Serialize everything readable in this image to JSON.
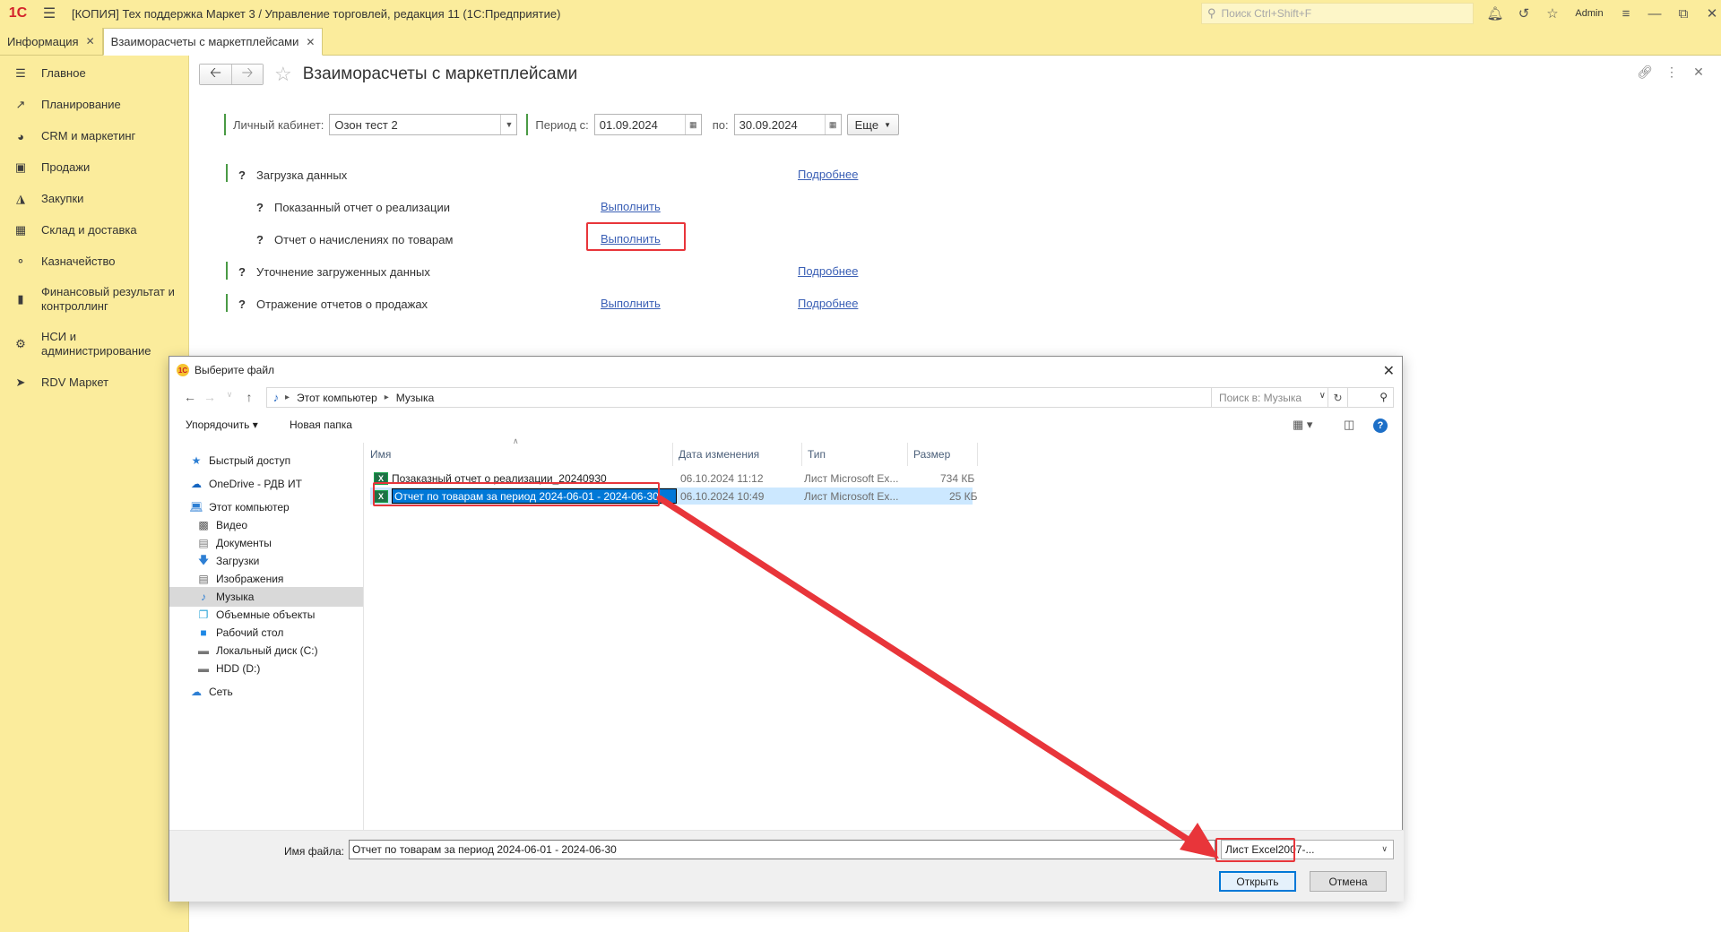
{
  "titlebar": {
    "logo": "1С",
    "title": "[КОПИЯ] Тех поддержка Маркет 3 / Управление торговлей, редакция 11  (1С:Предприятие)",
    "search_placeholder": "Поиск Ctrl+Shift+F",
    "user": "Admin"
  },
  "tabs": [
    {
      "label": "Информация"
    },
    {
      "label": "Взаиморасчеты с маркетплейсами"
    }
  ],
  "sidebar": {
    "items": [
      {
        "label": "Главное",
        "icon": "menu-icon"
      },
      {
        "label": "Планирование",
        "icon": "chart-icon"
      },
      {
        "label": "CRM и маркетинг",
        "icon": "pie-icon"
      },
      {
        "label": "Продажи",
        "icon": "bag-icon"
      },
      {
        "label": "Закупки",
        "icon": "cart-icon"
      },
      {
        "label": "Склад и доставка",
        "icon": "grid-icon"
      },
      {
        "label": "Казначейство",
        "icon": "coins-icon"
      },
      {
        "label": "Финансовый результат и контроллинг",
        "icon": "bar-chart-icon"
      },
      {
        "label": "НСИ и администрирование",
        "icon": "gear-icon"
      },
      {
        "label": "RDV Маркет",
        "icon": "rocket-icon"
      }
    ]
  },
  "page": {
    "title": "Взаиморасчеты с маркетплейсами",
    "filters": {
      "cabinet_label": "Личный кабинет:",
      "cabinet_value": "Озон тест 2",
      "period_from_label": "Период с:",
      "period_from": "01.09.2024",
      "period_to_label": "по:",
      "period_to": "30.09.2024",
      "more_label": "Еще"
    },
    "steps": [
      {
        "q": "?",
        "label": "Загрузка данных",
        "link2": "Подробнее"
      },
      {
        "q": "?",
        "label": "Показанный отчет о реализации",
        "link1": "Выполнить"
      },
      {
        "q": "?",
        "label": "Отчет о начислениях по товарам",
        "link1": "Выполнить"
      },
      {
        "q": "?",
        "label": "Уточнение загруженных данных",
        "link2": "Подробнее"
      },
      {
        "q": "?",
        "label": "Отражение отчетов о продажах",
        "link1": "Выполнить",
        "link2": "Подробнее"
      }
    ]
  },
  "dialog": {
    "title": "Выберите файл",
    "path": [
      "Этот компьютер",
      "Музыка"
    ],
    "search_placeholder": "Поиск в: Музыка",
    "organize_label": "Упорядочить ▾",
    "new_folder_label": "Новая папка",
    "help": "?",
    "tree": [
      {
        "label": "Быстрый доступ",
        "icon": "star-icon"
      },
      {
        "label": "OneDrive - РДВ ИТ",
        "icon": "cloud-icon"
      },
      {
        "label": "Этот компьютер",
        "icon": "computer-icon"
      },
      {
        "label": "Видео",
        "icon": "video-icon"
      },
      {
        "label": "Документы",
        "icon": "document-icon"
      },
      {
        "label": "Загрузки",
        "icon": "download-icon"
      },
      {
        "label": "Изображения",
        "icon": "image-icon"
      },
      {
        "label": "Музыка",
        "icon": "music-icon"
      },
      {
        "label": "Объемные объекты",
        "icon": "cube-icon"
      },
      {
        "label": "Рабочий стол",
        "icon": "desktop-icon"
      },
      {
        "label": "Локальный диск (C:)",
        "icon": "drive-icon"
      },
      {
        "label": "HDD (D:)",
        "icon": "hdd-icon"
      },
      {
        "label": "Сеть",
        "icon": "network-icon"
      }
    ],
    "columns": [
      "Имя",
      "Дата изменения",
      "Тип",
      "Размер"
    ],
    "files": [
      {
        "name": "Позаказный отчет о реализации_20240930",
        "date": "06.10.2024 11:12",
        "type": "Лист Microsoft Ex...",
        "size": "734 КБ"
      },
      {
        "name": "Отчет по товарам за период 2024-06-01 - 2024-06-30",
        "date": "06.10.2024 10:49",
        "type": "Лист Microsoft Ex...",
        "size": "25 КБ"
      }
    ],
    "filename_label": "Имя файла:",
    "filename_value": "Отчет по товарам за период 2024-06-01 - 2024-06-30",
    "filetype_value": "Лист Excel2007-...",
    "open_label": "Открыть",
    "cancel_label": "Отмена"
  },
  "annotation_color": "#e8353a"
}
